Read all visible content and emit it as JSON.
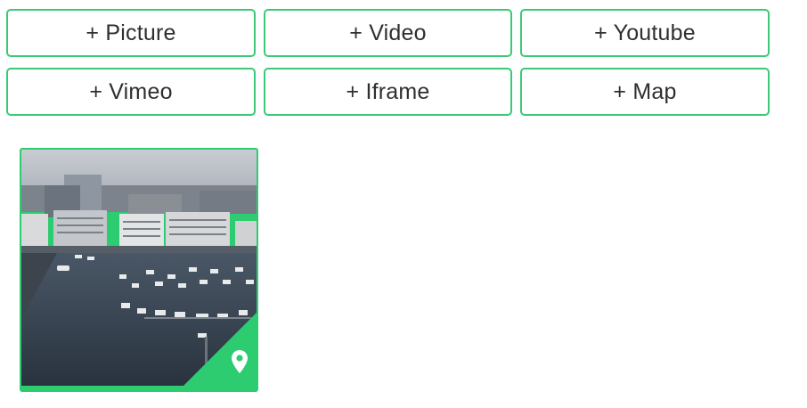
{
  "buttons": [
    {
      "label": "+ Picture"
    },
    {
      "label": "+ Video"
    },
    {
      "label": "+ Youtube"
    },
    {
      "label": "+ Vimeo"
    },
    {
      "label": "+ Iframe"
    },
    {
      "label": "+ Map"
    }
  ],
  "media_items": [
    {
      "type": "picture",
      "badge_icon": "map-pin-icon",
      "description": "aerial harbor with boats"
    }
  ],
  "colors": {
    "accent": "#2ecc71",
    "button_border": "#3cc977",
    "button_text": "#2f2f2f"
  }
}
